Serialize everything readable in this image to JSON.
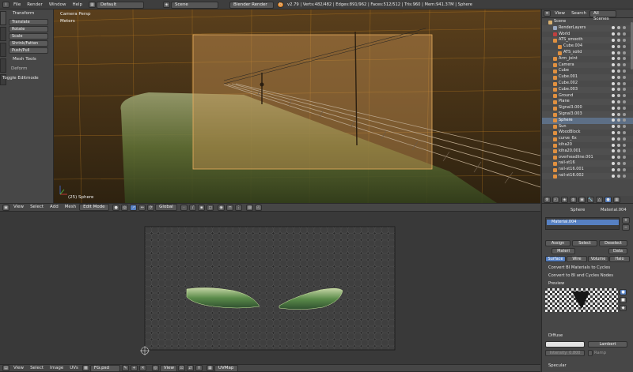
{
  "topbar": {
    "menus": [
      "File",
      "Render",
      "Window",
      "Help"
    ],
    "layout": "Default",
    "scene": "Scene",
    "engine": "Blender Render",
    "stats": "v2.79 | Verts:482/482 | Edges:891/962 | Faces:512/512 | Tris:960 | Mem:941.37M | Sphere"
  },
  "toolshelf": {
    "tabs": [
      "Tools",
      "Create",
      "Shading",
      "Grease",
      "Options"
    ],
    "transform_header": "Transform",
    "transform_buttons": [
      "Translate",
      "Rotate",
      "Scale",
      "Shrink/Fatten",
      "Push/Pull"
    ],
    "mesh_tools_header": "Mesh Tools",
    "deform_label": "Deform",
    "toggle_label": "Toggle Editmode"
  },
  "viewport": {
    "camera_label": "Camera Persp",
    "units_label": "Meters",
    "object_label": "(25) Sphere"
  },
  "viewport_header": {
    "menus": [
      "View",
      "Select",
      "Add",
      "Mesh"
    ],
    "mode": "Edit Mode",
    "orientation": "Global"
  },
  "outliner": {
    "menus": [
      "View",
      "Search"
    ],
    "filter": "All Scenes",
    "items": [
      {
        "label": "Scene",
        "indent": 0,
        "icon": "#d8b070"
      },
      {
        "label": "RenderLayers",
        "indent": 1,
        "icon": "#9aa8c0"
      },
      {
        "label": "World",
        "indent": 1,
        "icon": "#c04040"
      },
      {
        "label": "ATS_smooth",
        "indent": 1,
        "icon": "#e09040"
      },
      {
        "label": "Cube.004",
        "indent": 2,
        "icon": "#e09040"
      },
      {
        "label": "ATS_solid",
        "indent": 2,
        "icon": "#e09040"
      },
      {
        "label": "Arm_joint",
        "indent": 1,
        "icon": "#e09040"
      },
      {
        "label": "Camera",
        "indent": 1,
        "icon": "#e09040"
      },
      {
        "label": "Cube",
        "indent": 1,
        "icon": "#e09040"
      },
      {
        "label": "Cube.001",
        "indent": 1,
        "icon": "#e09040"
      },
      {
        "label": "Cube.002",
        "indent": 1,
        "icon": "#e09040"
      },
      {
        "label": "Cube.003",
        "indent": 1,
        "icon": "#e09040"
      },
      {
        "label": "Ground",
        "indent": 1,
        "icon": "#e09040"
      },
      {
        "label": "Plane",
        "indent": 1,
        "icon": "#e09040"
      },
      {
        "label": "Signal3.000",
        "indent": 1,
        "icon": "#e09040"
      },
      {
        "label": "Signal3.003",
        "indent": 1,
        "icon": "#e09040"
      },
      {
        "label": "Sphere",
        "indent": 1,
        "icon": "#e09040",
        "selected": true
      },
      {
        "label": "Sun",
        "indent": 1,
        "icon": "#e09040"
      },
      {
        "label": "WoodBlock",
        "indent": 1,
        "icon": "#e09040"
      },
      {
        "label": "curve_6x",
        "indent": 1,
        "icon": "#e09040"
      },
      {
        "label": "kiha20",
        "indent": 1,
        "icon": "#e09040"
      },
      {
        "label": "kiha20.001",
        "indent": 1,
        "icon": "#e09040"
      },
      {
        "label": "overheadline.001",
        "indent": 1,
        "icon": "#e09040"
      },
      {
        "label": "rail-st16",
        "indent": 1,
        "icon": "#e09040"
      },
      {
        "label": "rail-st16.001",
        "indent": 1,
        "icon": "#e09040"
      },
      {
        "label": "rail-st16.002",
        "indent": 1,
        "icon": "#e09040"
      }
    ]
  },
  "properties": {
    "breadcrumb_object": "Sphere",
    "breadcrumb_material": "Material.004",
    "material_slot": "Material.004",
    "assign": "Assign",
    "select": "Select",
    "deselect": "Deselect",
    "material_name": "Materi",
    "data_label": "Data",
    "tabs": [
      "Surface",
      "Wire",
      "Volume",
      "Halo"
    ],
    "convert1": "Convert BI Materials to Cycles",
    "convert2": "Convert to BI and Cycles Nodes",
    "preview_header": "Preview",
    "diffuse_header": "Diffuse",
    "diffuse_shader": "Lambert",
    "intensity": "Intensity: 0.800",
    "ramp": "Ramp",
    "specular_header": "Specular"
  },
  "uv_header": {
    "menus": [
      "View",
      "Select",
      "Image",
      "UVs"
    ],
    "image": "FG.psd",
    "view": "View",
    "uvmap": "UVMap"
  },
  "colors": {
    "accent": "#5680c2",
    "selected_orange": "#f0a030",
    "viewport_bg": "#3a2a14"
  }
}
